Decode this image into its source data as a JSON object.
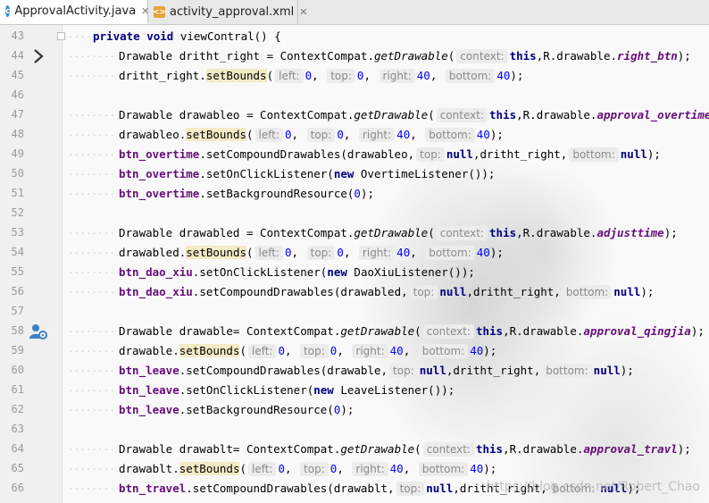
{
  "tabs": [
    {
      "label": "ApprovalActivity.java",
      "icon": "c-class-icon",
      "active": true
    },
    {
      "label": "activity_approval.xml",
      "icon": "xml-file-icon",
      "active": false
    }
  ],
  "watermark": "https://blog.csdn.net/Robert_Chao",
  "lines": [
    {
      "num": "43"
    },
    {
      "num": "44"
    },
    {
      "num": "45"
    },
    {
      "num": "46"
    },
    {
      "num": "47"
    },
    {
      "num": "48"
    },
    {
      "num": "49"
    },
    {
      "num": "50"
    },
    {
      "num": "51"
    },
    {
      "num": "52"
    },
    {
      "num": "53"
    },
    {
      "num": "54"
    },
    {
      "num": "55"
    },
    {
      "num": "56"
    },
    {
      "num": "57"
    },
    {
      "num": "58"
    },
    {
      "num": "59"
    },
    {
      "num": "60"
    },
    {
      "num": "61"
    },
    {
      "num": "62"
    },
    {
      "num": "63"
    },
    {
      "num": "64"
    },
    {
      "num": "65"
    },
    {
      "num": "66"
    }
  ],
  "code": {
    "l43": {
      "kw1": "private",
      "kw2": "void",
      "rest": " viewContral() {"
    },
    "l44": {
      "a": "Drawable dritht_right = ContextCompat.",
      "st": "getDrawable",
      "b": "(",
      "hint": "context:",
      "kw": "this",
      "c": ",R.drawable.",
      "res": "right_btn",
      "d": ");"
    },
    "l45": {
      "a": "dritht_right.",
      "hl": "setBounds",
      "b": "(",
      "h1": "left:",
      "n1": "0",
      "h2": "top:",
      "n2": "0",
      "h3": "right:",
      "n3": "40",
      "h4": "bottom:",
      "n4": "40",
      "d": ");"
    },
    "l47": {
      "a": "Drawable drawableo = ContextCompat.",
      "st": "getDrawable",
      "b": "(",
      "hint": "context:",
      "kw": "this",
      "c": ",R.drawable.",
      "res": "approval_overtime",
      "d": ");"
    },
    "l48": {
      "a": "drawableo.",
      "hl": "setBounds",
      "b": "(",
      "h1": "left:",
      "n1": "0",
      "h2": "top:",
      "n2": "0",
      "h3": "right:",
      "n3": "40",
      "h4": "bottom:",
      "n4": "40",
      "d": ");"
    },
    "l49": {
      "fld": "btn_overtime",
      "a": ".setCompoundDrawables(drawableo,",
      "hint1": "top:",
      "kw1": "null",
      "b": ",dritht_right,",
      "hint2": "bottom:",
      "kw2": "null",
      "d": ");"
    },
    "l50": {
      "fld": "btn_overtime",
      "a": ".setOnClickListener(",
      "kw": "new",
      "b": " OvertimeListener());"
    },
    "l51": {
      "fld": "btn_overtime",
      "a": ".setBackgroundResource(",
      "n": "0",
      "d": ");"
    },
    "l53": {
      "a": "Drawable drawabled = ContextCompat.",
      "st": "getDrawable",
      "b": "(",
      "hint": "context:",
      "kw": "this",
      "c": ",R.drawable.",
      "res": "adjusttime",
      "d": ");"
    },
    "l54": {
      "a": "drawabled.",
      "hl": "setBounds",
      "b": "(",
      "h1": "left:",
      "n1": "0",
      "h2": "top:",
      "n2": "0",
      "h3": "right:",
      "n3": "40",
      "h4": "bottom:",
      "n4": "40",
      "d": ");"
    },
    "l55": {
      "fld": "btn_dao_xiu",
      "a": ".setOnClickListener(",
      "kw": "new",
      "b": " DaoXiuListener());"
    },
    "l56": {
      "fld": "btn_dao_xiu",
      "a": ".setCompoundDrawables(drawabled,",
      "hint1": "top:",
      "kw1": "null",
      "b": ",dritht_right,",
      "hint2": "bottom:",
      "kw2": "null",
      "d": ");"
    },
    "l58": {
      "a": "Drawable drawable= ContextCompat.",
      "st": "getDrawable",
      "b": "(",
      "hint": "context:",
      "kw": "this",
      "c": ",R.drawable.",
      "res": "approval_qingjia",
      "d": ");"
    },
    "l59": {
      "a": "drawable.",
      "hl": "setBounds",
      "b": "(",
      "h1": "left:",
      "n1": "0",
      "h2": "top:",
      "n2": "0",
      "h3": "right:",
      "n3": "40",
      "h4": "bottom:",
      "n4": "40",
      "d": ");"
    },
    "l60": {
      "fld": "btn_leave",
      "a": ".setCompoundDrawables(drawable,",
      "hint1": "top:",
      "kw1": "null",
      "b": ",dritht_right,",
      "hint2": "bottom:",
      "kw2": "null",
      "d": ");"
    },
    "l61": {
      "fld": "btn_leave",
      "a": ".setOnClickListener(",
      "kw": "new",
      "b": " LeaveListener());"
    },
    "l62": {
      "fld": "btn_leave",
      "a": ".setBackgroundResource(",
      "n": "0",
      "d": ");"
    },
    "l64": {
      "a": "Drawable drawablt= ContextCompat.",
      "st": "getDrawable",
      "b": "(",
      "hint": "context:",
      "kw": "this",
      "c": ",R.drawable.",
      "res": "approval_travl",
      "d": ");"
    },
    "l65": {
      "a": "drawablt.",
      "hl": "setBounds",
      "b": "(",
      "h1": "left:",
      "n1": "0",
      "h2": "top:",
      "n2": "0",
      "h3": "right:",
      "n3": "40",
      "h4": "bottom:",
      "n4": "40",
      "d": ");"
    },
    "l66": {
      "fld": "btn_travel",
      "a": ".setCompoundDrawables(drawablt,",
      "hint1": "top:",
      "kw1": "null",
      "b": ",dritht_right,",
      "hint2": "bottom:",
      "kw2": "null",
      "d": ");"
    }
  },
  "gutter_icons": {
    "l44": "arrow-right-icon",
    "l58": "user-gear-icon"
  }
}
